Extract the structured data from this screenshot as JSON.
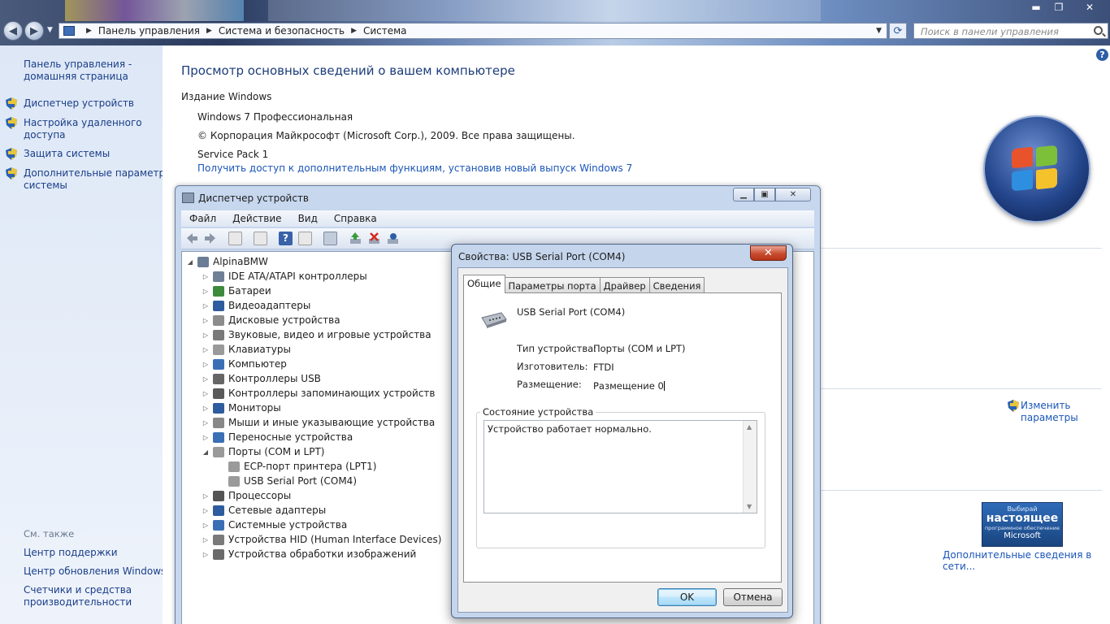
{
  "address": {
    "crumbs": [
      "Панель управления",
      "Система и безопасность",
      "Система"
    ],
    "search_placeholder": "Поиск в панели управления"
  },
  "window_controls": {
    "minimize": "▬",
    "maximize": "❐",
    "close": "✕"
  },
  "sidebar": {
    "home_line1": "Панель управления -",
    "home_line2": "домашняя страница",
    "items": [
      {
        "line1": "Диспетчер устройств",
        "line2": "",
        "icon": "shield-icon"
      },
      {
        "line1": "Настройка удаленного",
        "line2": "доступа",
        "icon": "shield-icon"
      },
      {
        "line1": "Защита системы",
        "line2": "",
        "icon": "shield-icon"
      },
      {
        "line1": "Дополнительные параметры",
        "line2": "системы",
        "icon": "shield-icon"
      }
    ],
    "see_also": "См. также",
    "see_also_links": [
      {
        "line1": "Центр поддержки",
        "line2": ""
      },
      {
        "line1": "Центр обновления Windows",
        "line2": ""
      },
      {
        "line1": "Счетчики и средства",
        "line2": "производительности"
      }
    ]
  },
  "main": {
    "title": "Просмотр основных сведений о вашем компьютере",
    "edition_header": "Издание Windows",
    "edition": "Windows 7 Профессиональная",
    "copyright": "© Корпорация Майкрософт (Microsoft Corp.), 2009. Все права защищены.",
    "service_pack": "Service Pack 1",
    "upgrade_link": "Получить доступ к дополнительным функциям, установив новый выпуск Windows 7",
    "change_params_line1": "Изменить",
    "change_params_line2": "параметры",
    "genuine": {
      "line1": "Выбирай",
      "line2": "настоящее",
      "line3": "программное обеспечение",
      "line4": "Microsoft"
    },
    "more_info_link": "Дополнительные сведения в сети..."
  },
  "device_manager": {
    "title": "Диспетчер устройств",
    "menu": [
      "Файл",
      "Действие",
      "Вид",
      "Справка"
    ],
    "root": "AlpinaBMW",
    "tree": [
      {
        "label": "IDE ATA/ATAPI контроллеры",
        "level": 1,
        "expander": "▷",
        "color": "#6f7f95"
      },
      {
        "label": "Батареи",
        "level": 1,
        "expander": "▷",
        "color": "#3d8a3d"
      },
      {
        "label": "Видеоадаптеры",
        "level": 1,
        "expander": "▷",
        "color": "#2e5c9e"
      },
      {
        "label": "Дисковые устройства",
        "level": 1,
        "expander": "▷",
        "color": "#8c8c8c"
      },
      {
        "label": "Звуковые, видео и игровые устройства",
        "level": 1,
        "expander": "▷",
        "color": "#7a7a7a"
      },
      {
        "label": "Клавиатуры",
        "level": 1,
        "expander": "▷",
        "color": "#9a9a9a"
      },
      {
        "label": "Компьютер",
        "level": 1,
        "expander": "▷",
        "color": "#3a6fb5"
      },
      {
        "label": "Контроллеры USB",
        "level": 1,
        "expander": "▷",
        "color": "#666666"
      },
      {
        "label": "Контроллеры запоминающих устройств",
        "level": 1,
        "expander": "▷",
        "color": "#5a5a5a"
      },
      {
        "label": "Мониторы",
        "level": 1,
        "expander": "▷",
        "color": "#2e5c9e"
      },
      {
        "label": "Мыши и иные указывающие устройства",
        "level": 1,
        "expander": "▷",
        "color": "#888888"
      },
      {
        "label": "Переносные устройства",
        "level": 1,
        "expander": "▷",
        "color": "#3a6fb5"
      },
      {
        "label": "Порты (COM и LPT)",
        "level": 1,
        "expander": "◢",
        "color": "#9a9a9a"
      },
      {
        "label": "ECP-порт принтера (LPT1)",
        "level": 2,
        "expander": "",
        "color": "#9a9a9a"
      },
      {
        "label": "USB Serial Port (COM4)",
        "level": 2,
        "expander": "",
        "color": "#9a9a9a"
      },
      {
        "label": "Процессоры",
        "level": 1,
        "expander": "▷",
        "color": "#555555"
      },
      {
        "label": "Сетевые адаптеры",
        "level": 1,
        "expander": "▷",
        "color": "#2e5c9e"
      },
      {
        "label": "Системные устройства",
        "level": 1,
        "expander": "▷",
        "color": "#3a6fb5"
      },
      {
        "label": "Устройства HID (Human Interface Devices)",
        "level": 1,
        "expander": "▷",
        "color": "#7a7a7a"
      },
      {
        "label": "Устройства обработки изображений",
        "level": 1,
        "expander": "▷",
        "color": "#6a6a6a"
      }
    ]
  },
  "properties": {
    "title": "Свойства: USB Serial Port (COM4)",
    "tabs": [
      "Общие",
      "Параметры порта",
      "Драйвер",
      "Сведения"
    ],
    "device_name": "USB Serial Port (COM4)",
    "type_label": "Тип устройства:",
    "type_value": "Порты (COM и LPT)",
    "manufacturer_label": "Изготовитель:",
    "manufacturer_value": "FTDI",
    "location_label": "Размещение:",
    "location_value": "Размещение 0",
    "status_group": "Состояние устройства",
    "status_text": "Устройство работает нормально.",
    "ok": "OK",
    "cancel": "Отмена"
  },
  "colors": {
    "link": "#1a55b8",
    "title": "#1c3d7a",
    "close_red": "#c84c2f"
  }
}
